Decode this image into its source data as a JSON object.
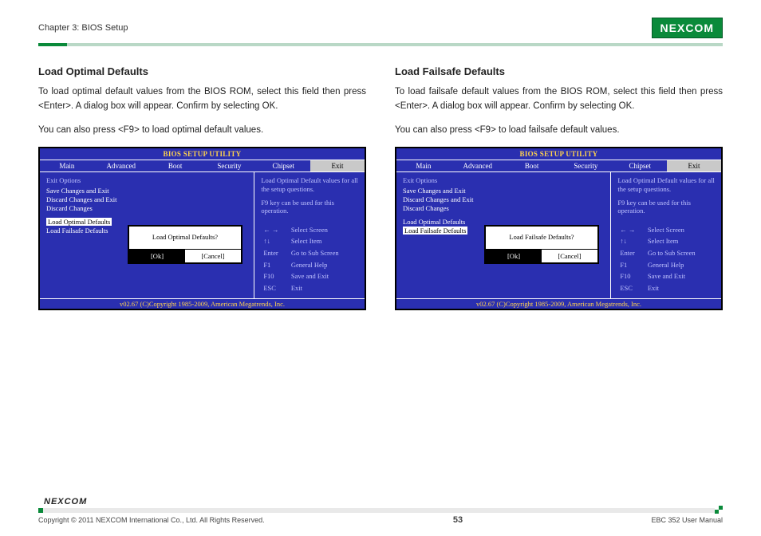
{
  "header": {
    "chapter": "Chapter 3: BIOS Setup",
    "logo": "NEXCOM"
  },
  "left": {
    "heading": "Load Optimal Defaults",
    "p1": "To load optimal default values from the BIOS ROM, select this field then press <Enter>. A dialog box will appear. Confirm by selecting OK.",
    "p2": "You can also press <F9> to load optimal default values."
  },
  "right": {
    "heading": "Load Failsafe Defaults",
    "p1": "To load failsafe default values from the BIOS ROM, select this field then press <Enter>. A dialog box will appear. Confirm by selecting OK.",
    "p2": "You can also press <F9> to load failsafe default values."
  },
  "bios": {
    "title": "BIOS SETUP UTILITY",
    "tabs": [
      "Main",
      "Advanced",
      "Boot",
      "Security",
      "Chipset",
      "Exit"
    ],
    "active_tab": "Exit",
    "heading": "Exit Options",
    "items": [
      "Save Changes and Exit",
      "Discard Changes and Exit",
      "Discard Changes"
    ],
    "items2": [
      "Load Optimal Defaults",
      "Load Failsafe Defaults"
    ],
    "hint": "Load Optimal Default values for all the setup questions.",
    "hint2": "F9 key can be used for this operation.",
    "keys": [
      [
        "← →",
        "Select Screen"
      ],
      [
        "↑↓",
        "Select Item"
      ],
      [
        "Enter",
        "Go to Sub Screen"
      ],
      [
        "F1",
        "General Help"
      ],
      [
        "F10",
        "Save and Exit"
      ],
      [
        "ESC",
        "Exit"
      ]
    ],
    "footer": "v02.67 (C)Copyright 1985-2009, American Megatrends, Inc.",
    "dlg_left": {
      "q": "Load Optimal Defaults?",
      "ok": "[Ok]",
      "cancel": "[Cancel]",
      "selected": "Load Optimal Defaults"
    },
    "dlg_right": {
      "q": "Load Failsafe Defaults?",
      "ok": "[Ok]",
      "cancel": "[Cancel]",
      "selected": "Load Failsafe Defaults"
    }
  },
  "footer": {
    "logo": "NEXCOM",
    "copyright": "Copyright © 2011 NEXCOM International Co., Ltd. All Rights Reserved.",
    "page": "53",
    "doc": "EBC 352 User Manual"
  }
}
